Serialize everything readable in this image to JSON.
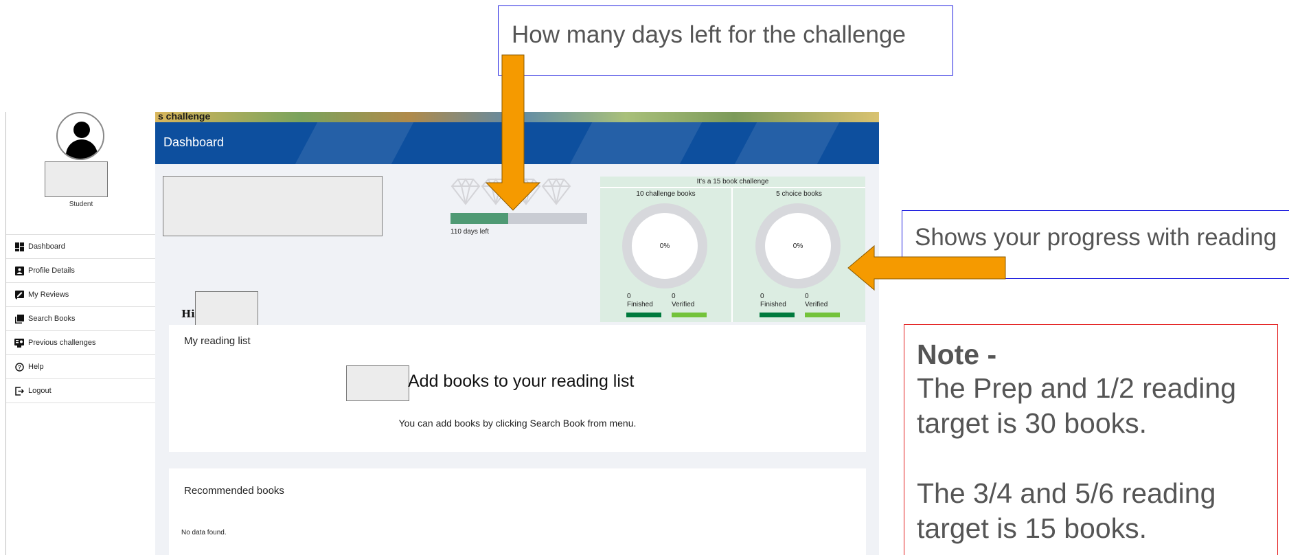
{
  "colors": {
    "header": "#0d4f9e",
    "progress_fill": "#4f9a74",
    "finished_bar": "#007a3d",
    "verified_bar": "#73c33a",
    "callout_border_blue": "#1f1fdf",
    "note_border_red": "#e31b1b",
    "arrow_fill": "#f59a00"
  },
  "sidebar": {
    "role": "Student",
    "items": [
      {
        "label": "Dashboard",
        "icon": "dashboard-icon"
      },
      {
        "label": "Profile Details",
        "icon": "profile-icon"
      },
      {
        "label": "My Reviews",
        "icon": "review-icon"
      },
      {
        "label": "Search Books",
        "icon": "books-icon"
      },
      {
        "label": "Previous challenges",
        "icon": "history-icon"
      },
      {
        "label": "Help",
        "icon": "help-icon"
      },
      {
        "label": "Logout",
        "icon": "logout-icon"
      }
    ]
  },
  "banner": {
    "text": "s challenge"
  },
  "header": {
    "title": "Dashboard"
  },
  "progress": {
    "fraction": 0.42,
    "days_left": "110 days left"
  },
  "target": {
    "heading": "It's a 15 book challenge",
    "columns": [
      {
        "title": "10 challenge books",
        "percent": "0%",
        "finished": "0",
        "finished_label": "Finished",
        "verified": "0",
        "verified_label": "Verified"
      },
      {
        "title": "5 choice books",
        "percent": "0%",
        "finished": "0",
        "finished_label": "Finished",
        "verified": "0",
        "verified_label": "Verified"
      }
    ]
  },
  "greeting": "Hi",
  "reading_list": {
    "title": "My reading list",
    "add_title": "Add books to your reading list",
    "add_sub": "You can add books by clicking Search Book from menu."
  },
  "recommended": {
    "title": "Recommended books",
    "empty": "No data found."
  },
  "annotations": {
    "days": "How many days left for the challenge",
    "progress": "Shows your progress with reading",
    "note_head": "Note -",
    "note_lines": [
      "The Prep and 1/2 reading",
      "target is 30 books.",
      "",
      "The 3/4 and 5/6 reading",
      "target is 15 books."
    ]
  }
}
